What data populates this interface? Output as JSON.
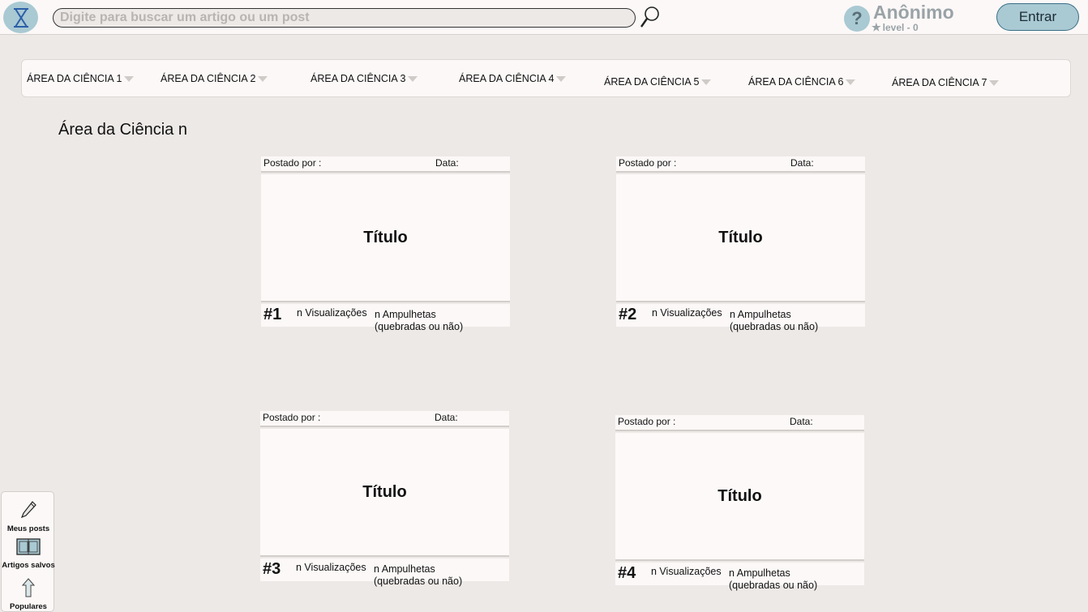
{
  "header": {
    "search_placeholder": "Digite para buscar um artigo ou um post",
    "help_label": "?",
    "user_name": "Anônimo",
    "user_level": "level - 0",
    "enter_label": "Entrar"
  },
  "categories": [
    {
      "label": "ÁREA DA CIÊNCIA 1"
    },
    {
      "label": "ÁREA DA CIÊNCIA 2"
    },
    {
      "label": "ÁREA DA CIÊNCIA 3"
    },
    {
      "label": "ÁREA DA CIÊNCIA 4"
    },
    {
      "label": "ÁREA DA CIÊNCIA 5"
    },
    {
      "label": "ÁREA DA CIÊNCIA 6"
    },
    {
      "label": "ÁREA DA CIÊNCIA 7"
    }
  ],
  "section_title": "Área da Ciência n",
  "posts": [
    {
      "posted_by": "Postado por :",
      "date": "Data:",
      "title": "Título",
      "rank": "#1",
      "views": "n Visualizações",
      "hourglasses_1": "n Ampulhetas",
      "hourglasses_2": "(quebradas ou não)"
    },
    {
      "posted_by": "Postado por :",
      "date": "Data:",
      "title": "Título",
      "rank": "#2",
      "views": "n Visualizações",
      "hourglasses_1": "n Ampulhetas",
      "hourglasses_2": "(quebradas ou não)"
    },
    {
      "posted_by": "Postado por :",
      "date": "Data:",
      "title": "Título",
      "rank": "#3",
      "views": "n Visualizações",
      "hourglasses_1": "n Ampulhetas",
      "hourglasses_2": "(quebradas ou não)"
    },
    {
      "posted_by": "Postado por :",
      "date": "Data:",
      "title": "Título",
      "rank": "#4",
      "views": "n Visualizações",
      "hourglasses_1": "n Ampulhetas",
      "hourglasses_2": "(quebradas ou não)"
    }
  ],
  "side_menu": {
    "my_posts": "Meus posts",
    "saved_articles": "Artigos salvos",
    "popular": "Populares"
  },
  "colors": {
    "background": "#ede9e7",
    "accent": "#a9c9d3",
    "accent_dark": "#3b6e86"
  }
}
